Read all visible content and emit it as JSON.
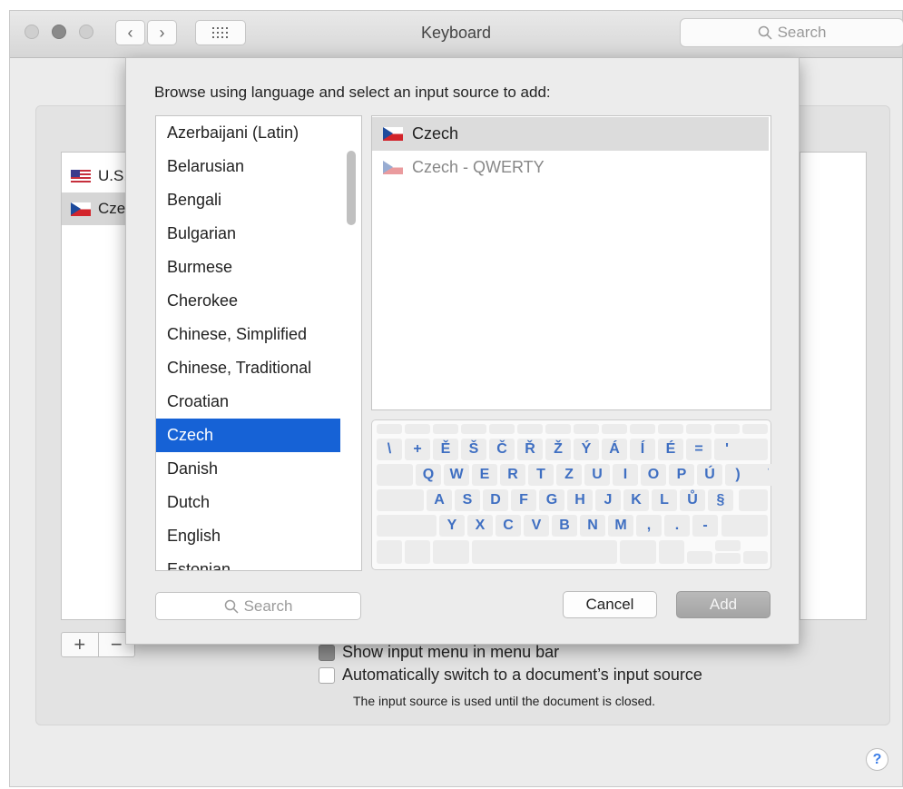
{
  "window": {
    "title": "Keyboard",
    "search_placeholder": "Search"
  },
  "background": {
    "sources": [
      {
        "label": "U.S.",
        "flag": "us-flag-icon"
      },
      {
        "label": "Czech",
        "flag": "czech-flag-icon"
      }
    ],
    "add_symbol": "+",
    "remove_symbol": "−",
    "show_menu_label": "Show input menu in menu bar",
    "auto_switch_label": "Automatically switch to a document’s input source",
    "hint": "The input source is used until the document is closed."
  },
  "sheet": {
    "prompt": "Browse using language and select an input source to add:",
    "languages": [
      "Azerbaijani (Latin)",
      "Belarusian",
      "Bengali",
      "Bulgarian",
      "Burmese",
      "Cherokee",
      "Chinese, Simplified",
      "Chinese, Traditional",
      "Croatian",
      "Czech",
      "Danish",
      "Dutch",
      "English",
      "Estonian"
    ],
    "selected_language": "Czech",
    "input_sources": [
      {
        "label": "Czech",
        "selected": true
      },
      {
        "label": "Czech - QWERTY",
        "selected": false
      }
    ],
    "keyboard_rows": [
      [
        "\\",
        "+",
        "Ě",
        "Š",
        "Č",
        "Ř",
        "Ž",
        "Ý",
        "Á",
        "Í",
        "É",
        "=",
        "'"
      ],
      [
        "Q",
        "W",
        "E",
        "R",
        "T",
        "Z",
        "U",
        "I",
        "O",
        "P",
        "Ú",
        ")",
        "¨"
      ],
      [
        "A",
        "S",
        "D",
        "F",
        "G",
        "H",
        "J",
        "K",
        "L",
        "Ů",
        "§"
      ],
      [
        "Y",
        "X",
        "C",
        "V",
        "B",
        "N",
        "M",
        ",",
        ".",
        "-"
      ]
    ],
    "search_placeholder": "Search",
    "cancel_label": "Cancel",
    "add_label": "Add"
  },
  "help_symbol": "?"
}
